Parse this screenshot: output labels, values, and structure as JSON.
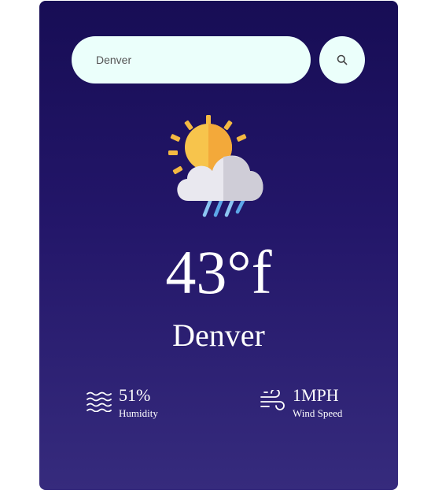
{
  "search": {
    "value": "Denver",
    "button_icon": "search-icon"
  },
  "weather": {
    "icon": "sun-cloud-rain-icon",
    "temperature": "43°f",
    "city": "Denver"
  },
  "details": {
    "humidity": {
      "icon": "humidity-waves-icon",
      "value": "51%",
      "label": "Humidity"
    },
    "wind": {
      "icon": "wind-icon",
      "value": "1MPH",
      "label": "Wind Speed"
    }
  },
  "colors": {
    "card_top": "#170d55",
    "card_bottom": "#362b7d",
    "input_bg": "#ebfffb",
    "text": "#ffffff"
  }
}
